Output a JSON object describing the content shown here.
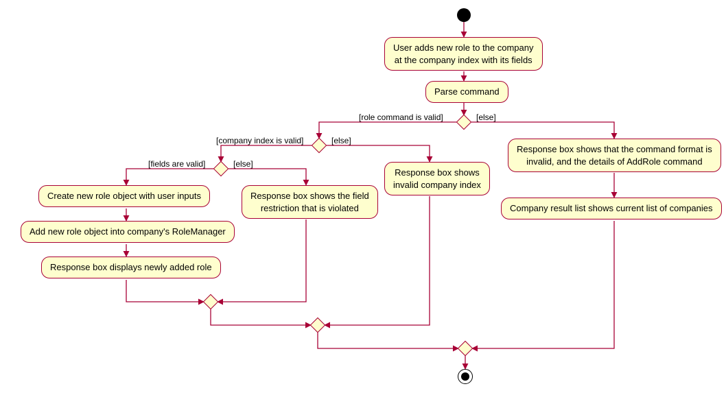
{
  "chart_data": {
    "type": "activity-diagram",
    "title": "",
    "nodes": [
      {
        "id": "start",
        "kind": "start"
      },
      {
        "id": "n1",
        "kind": "action",
        "text": "User adds new role to the company\nat the company index with its fields"
      },
      {
        "id": "n2",
        "kind": "action",
        "text": "Parse command"
      },
      {
        "id": "d1",
        "kind": "decision"
      },
      {
        "id": "d2",
        "kind": "decision"
      },
      {
        "id": "d3",
        "kind": "decision"
      },
      {
        "id": "n3",
        "kind": "action",
        "text": "Create new role object with user inputs"
      },
      {
        "id": "n4",
        "kind": "action",
        "text": "Add new role object into company's RoleManager"
      },
      {
        "id": "n5",
        "kind": "action",
        "text": "Response box displays newly added role"
      },
      {
        "id": "n6",
        "kind": "action",
        "text": "Response box shows the field\nrestriction that is violated"
      },
      {
        "id": "n7",
        "kind": "action",
        "text": "Response box shows\ninvalid company index"
      },
      {
        "id": "n8",
        "kind": "action",
        "text": "Response box shows that the command format is\ninvalid, and the details of AddRole command"
      },
      {
        "id": "n9",
        "kind": "action",
        "text": "Company result list shows current list of companies"
      },
      {
        "id": "m1",
        "kind": "merge"
      },
      {
        "id": "m2",
        "kind": "merge"
      },
      {
        "id": "m3",
        "kind": "merge"
      },
      {
        "id": "end",
        "kind": "end"
      }
    ],
    "edges": [
      {
        "from": "start",
        "to": "n1"
      },
      {
        "from": "n1",
        "to": "n2"
      },
      {
        "from": "n2",
        "to": "d1"
      },
      {
        "from": "d1",
        "to": "d2",
        "guard": "[role command is valid]"
      },
      {
        "from": "d1",
        "to": "n8",
        "guard": "[else]"
      },
      {
        "from": "n8",
        "to": "n9"
      },
      {
        "from": "d2",
        "to": "d3",
        "guard": "[company index is valid]"
      },
      {
        "from": "d2",
        "to": "n7",
        "guard": "[else]"
      },
      {
        "from": "d3",
        "to": "n3",
        "guard": "[fields are valid]"
      },
      {
        "from": "d3",
        "to": "n6",
        "guard": "[else]"
      },
      {
        "from": "n3",
        "to": "n4"
      },
      {
        "from": "n4",
        "to": "n5"
      },
      {
        "from": "n5",
        "to": "m1"
      },
      {
        "from": "n6",
        "to": "m1"
      },
      {
        "from": "m1",
        "to": "m2"
      },
      {
        "from": "n7",
        "to": "m2"
      },
      {
        "from": "m2",
        "to": "m3"
      },
      {
        "from": "n9",
        "to": "m3"
      },
      {
        "from": "m3",
        "to": "end"
      }
    ]
  },
  "guards": {
    "d1_left": "[role command is valid]",
    "d1_right": "[else]",
    "d2_left": "[company index is valid]",
    "d2_right": "[else]",
    "d3_left": "[fields are valid]",
    "d3_right": "[else]"
  },
  "labels": {
    "n1": "User adds new role to the company\nat the company index with its fields",
    "n2": "Parse command",
    "n3": "Create new role object with user inputs",
    "n4": "Add new role object into company's RoleManager",
    "n5": "Response box displays newly added role",
    "n6": "Response box shows the field\nrestriction that is violated",
    "n7": "Response box shows\ninvalid company index",
    "n8": "Response box shows that the command format is\ninvalid, and the details of AddRole command",
    "n9": "Company result list shows current list of companies"
  }
}
